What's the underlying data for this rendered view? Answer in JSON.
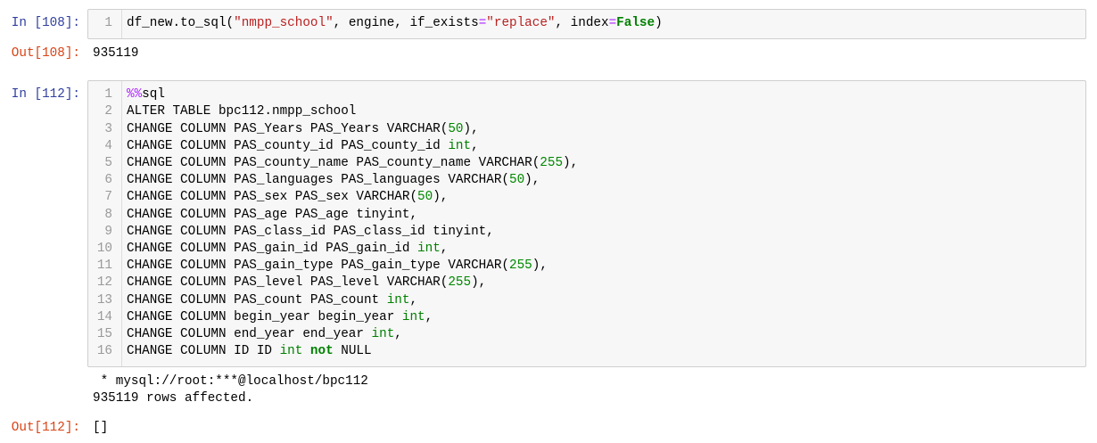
{
  "notebook": {
    "colors": {
      "in_prompt": "#303F9F",
      "out_prompt": "#D84315",
      "line_number": "#999999",
      "input_background": "#F7F7F7",
      "input_border": "#CFCFCF"
    },
    "cells": [
      {
        "in_prompt": "In [108]:",
        "lines": [
          {
            "n": "1",
            "tokens": [
              {
                "text": "df_new.to_sql("
              },
              {
                "text": "\"nmpp_school\"",
                "color": "#BA2121"
              },
              {
                "text": ", engine, if_exists"
              },
              {
                "text": "=",
                "color": "#AA22FF"
              },
              {
                "text": "\"replace\"",
                "color": "#BA2121"
              },
              {
                "text": ", index"
              },
              {
                "text": "=",
                "color": "#AA22FF"
              },
              {
                "text": "False",
                "color": "#008000",
                "bold": true
              },
              {
                "text": ")"
              }
            ]
          }
        ],
        "out_prompt": "Out[108]:",
        "result": "935119"
      },
      {
        "in_prompt": "In [112]:",
        "lines": [
          {
            "n": "1",
            "tokens": [
              {
                "text": "%%",
                "color": "#AA22FF"
              },
              {
                "text": "sql"
              }
            ]
          },
          {
            "n": "2",
            "tokens": [
              {
                "text": "ALTER TABLE bpc112.nmpp_school"
              }
            ]
          },
          {
            "n": "3",
            "tokens": [
              {
                "text": "CHANGE COLUMN PAS_Years PAS_Years VARCHAR("
              },
              {
                "text": "50",
                "color": "#008800"
              },
              {
                "text": "),"
              }
            ]
          },
          {
            "n": "4",
            "tokens": [
              {
                "text": "CHANGE COLUMN PAS_county_id PAS_county_id "
              },
              {
                "text": "int",
                "color": "#008000"
              },
              {
                "text": ","
              }
            ]
          },
          {
            "n": "5",
            "tokens": [
              {
                "text": "CHANGE COLUMN PAS_county_name PAS_county_name VARCHAR("
              },
              {
                "text": "255",
                "color": "#008800"
              },
              {
                "text": "),"
              }
            ]
          },
          {
            "n": "6",
            "tokens": [
              {
                "text": "CHANGE COLUMN PAS_languages PAS_languages VARCHAR("
              },
              {
                "text": "50",
                "color": "#008800"
              },
              {
                "text": "),"
              }
            ]
          },
          {
            "n": "7",
            "tokens": [
              {
                "text": "CHANGE COLUMN PAS_sex PAS_sex VARCHAR("
              },
              {
                "text": "50",
                "color": "#008800"
              },
              {
                "text": "),"
              }
            ]
          },
          {
            "n": "8",
            "tokens": [
              {
                "text": "CHANGE COLUMN PAS_age PAS_age tinyint,"
              }
            ]
          },
          {
            "n": "9",
            "tokens": [
              {
                "text": "CHANGE COLUMN PAS_class_id PAS_class_id tinyint,"
              }
            ]
          },
          {
            "n": "10",
            "tokens": [
              {
                "text": "CHANGE COLUMN PAS_gain_id PAS_gain_id "
              },
              {
                "text": "int",
                "color": "#008000"
              },
              {
                "text": ","
              }
            ]
          },
          {
            "n": "11",
            "tokens": [
              {
                "text": "CHANGE COLUMN PAS_gain_type PAS_gain_type VARCHAR("
              },
              {
                "text": "255",
                "color": "#008800"
              },
              {
                "text": "),"
              }
            ]
          },
          {
            "n": "12",
            "tokens": [
              {
                "text": "CHANGE COLUMN PAS_level PAS_level VARCHAR("
              },
              {
                "text": "255",
                "color": "#008800"
              },
              {
                "text": "),"
              }
            ]
          },
          {
            "n": "13",
            "tokens": [
              {
                "text": "CHANGE COLUMN PAS_count PAS_count "
              },
              {
                "text": "int",
                "color": "#008000"
              },
              {
                "text": ","
              }
            ]
          },
          {
            "n": "14",
            "tokens": [
              {
                "text": "CHANGE COLUMN begin_year begin_year "
              },
              {
                "text": "int",
                "color": "#008000"
              },
              {
                "text": ","
              }
            ]
          },
          {
            "n": "15",
            "tokens": [
              {
                "text": "CHANGE COLUMN end_year end_year "
              },
              {
                "text": "int",
                "color": "#008000"
              },
              {
                "text": ","
              }
            ]
          },
          {
            "n": "16",
            "tokens": [
              {
                "text": "CHANGE COLUMN ID ID "
              },
              {
                "text": "int ",
                "color": "#008000"
              },
              {
                "text": "not",
                "color": "#008000",
                "bold": true
              },
              {
                "text": " NULL"
              }
            ]
          }
        ],
        "stream_lines": [
          " * mysql://root:***@localhost/bpc112",
          "935119 rows affected."
        ],
        "out_prompt": "Out[112]:",
        "result": "[]"
      }
    ]
  }
}
